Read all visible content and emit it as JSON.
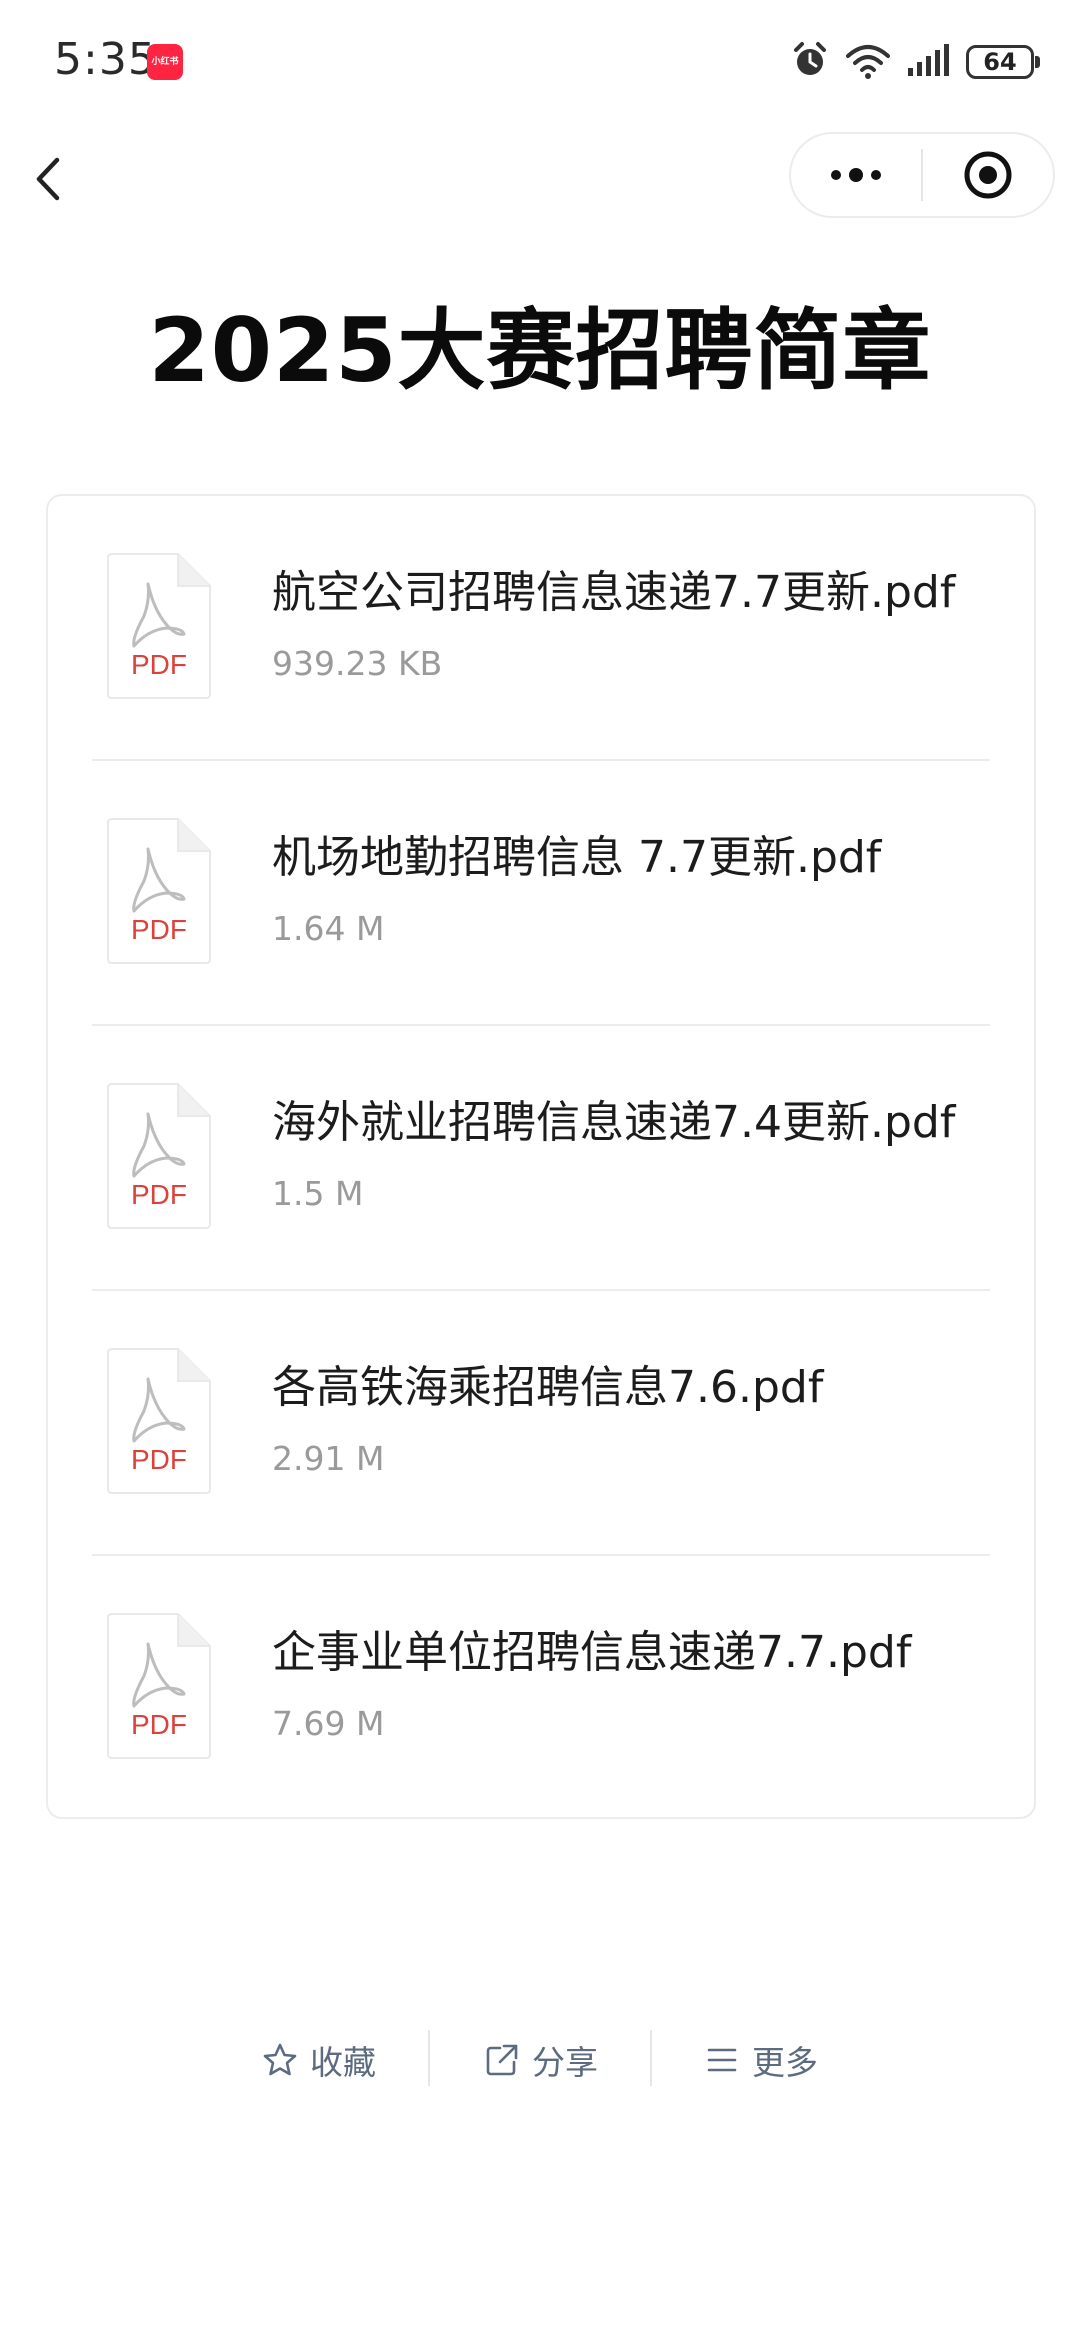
{
  "status_bar": {
    "time": "5:35",
    "app_badge": "小红书",
    "battery": "64"
  },
  "page": {
    "title": "2025大赛招聘简章"
  },
  "files": [
    {
      "name": "航空公司招聘信息速递7.7更新.pdf",
      "size": "939.23 KB",
      "type_label": "PDF"
    },
    {
      "name": "机场地勤招聘信息 7.7更新.pdf",
      "size": "1.64 M",
      "type_label": "PDF"
    },
    {
      "name": "海外就业招聘信息速递7.4更新.pdf",
      "size": "1.5 M",
      "type_label": "PDF"
    },
    {
      "name": "各高铁海乘招聘信息7.6.pdf",
      "size": "2.91 M",
      "type_label": "PDF"
    },
    {
      "name": "企事业单位招聘信息速递7.7.pdf",
      "size": "7.69 M",
      "type_label": "PDF"
    }
  ],
  "actions": {
    "favorite": "收藏",
    "share": "分享",
    "more": "更多"
  },
  "colors": {
    "pdf_red": "#d9433c",
    "action_text": "#5d6b80",
    "meta_gray": "#9a9a9a"
  }
}
